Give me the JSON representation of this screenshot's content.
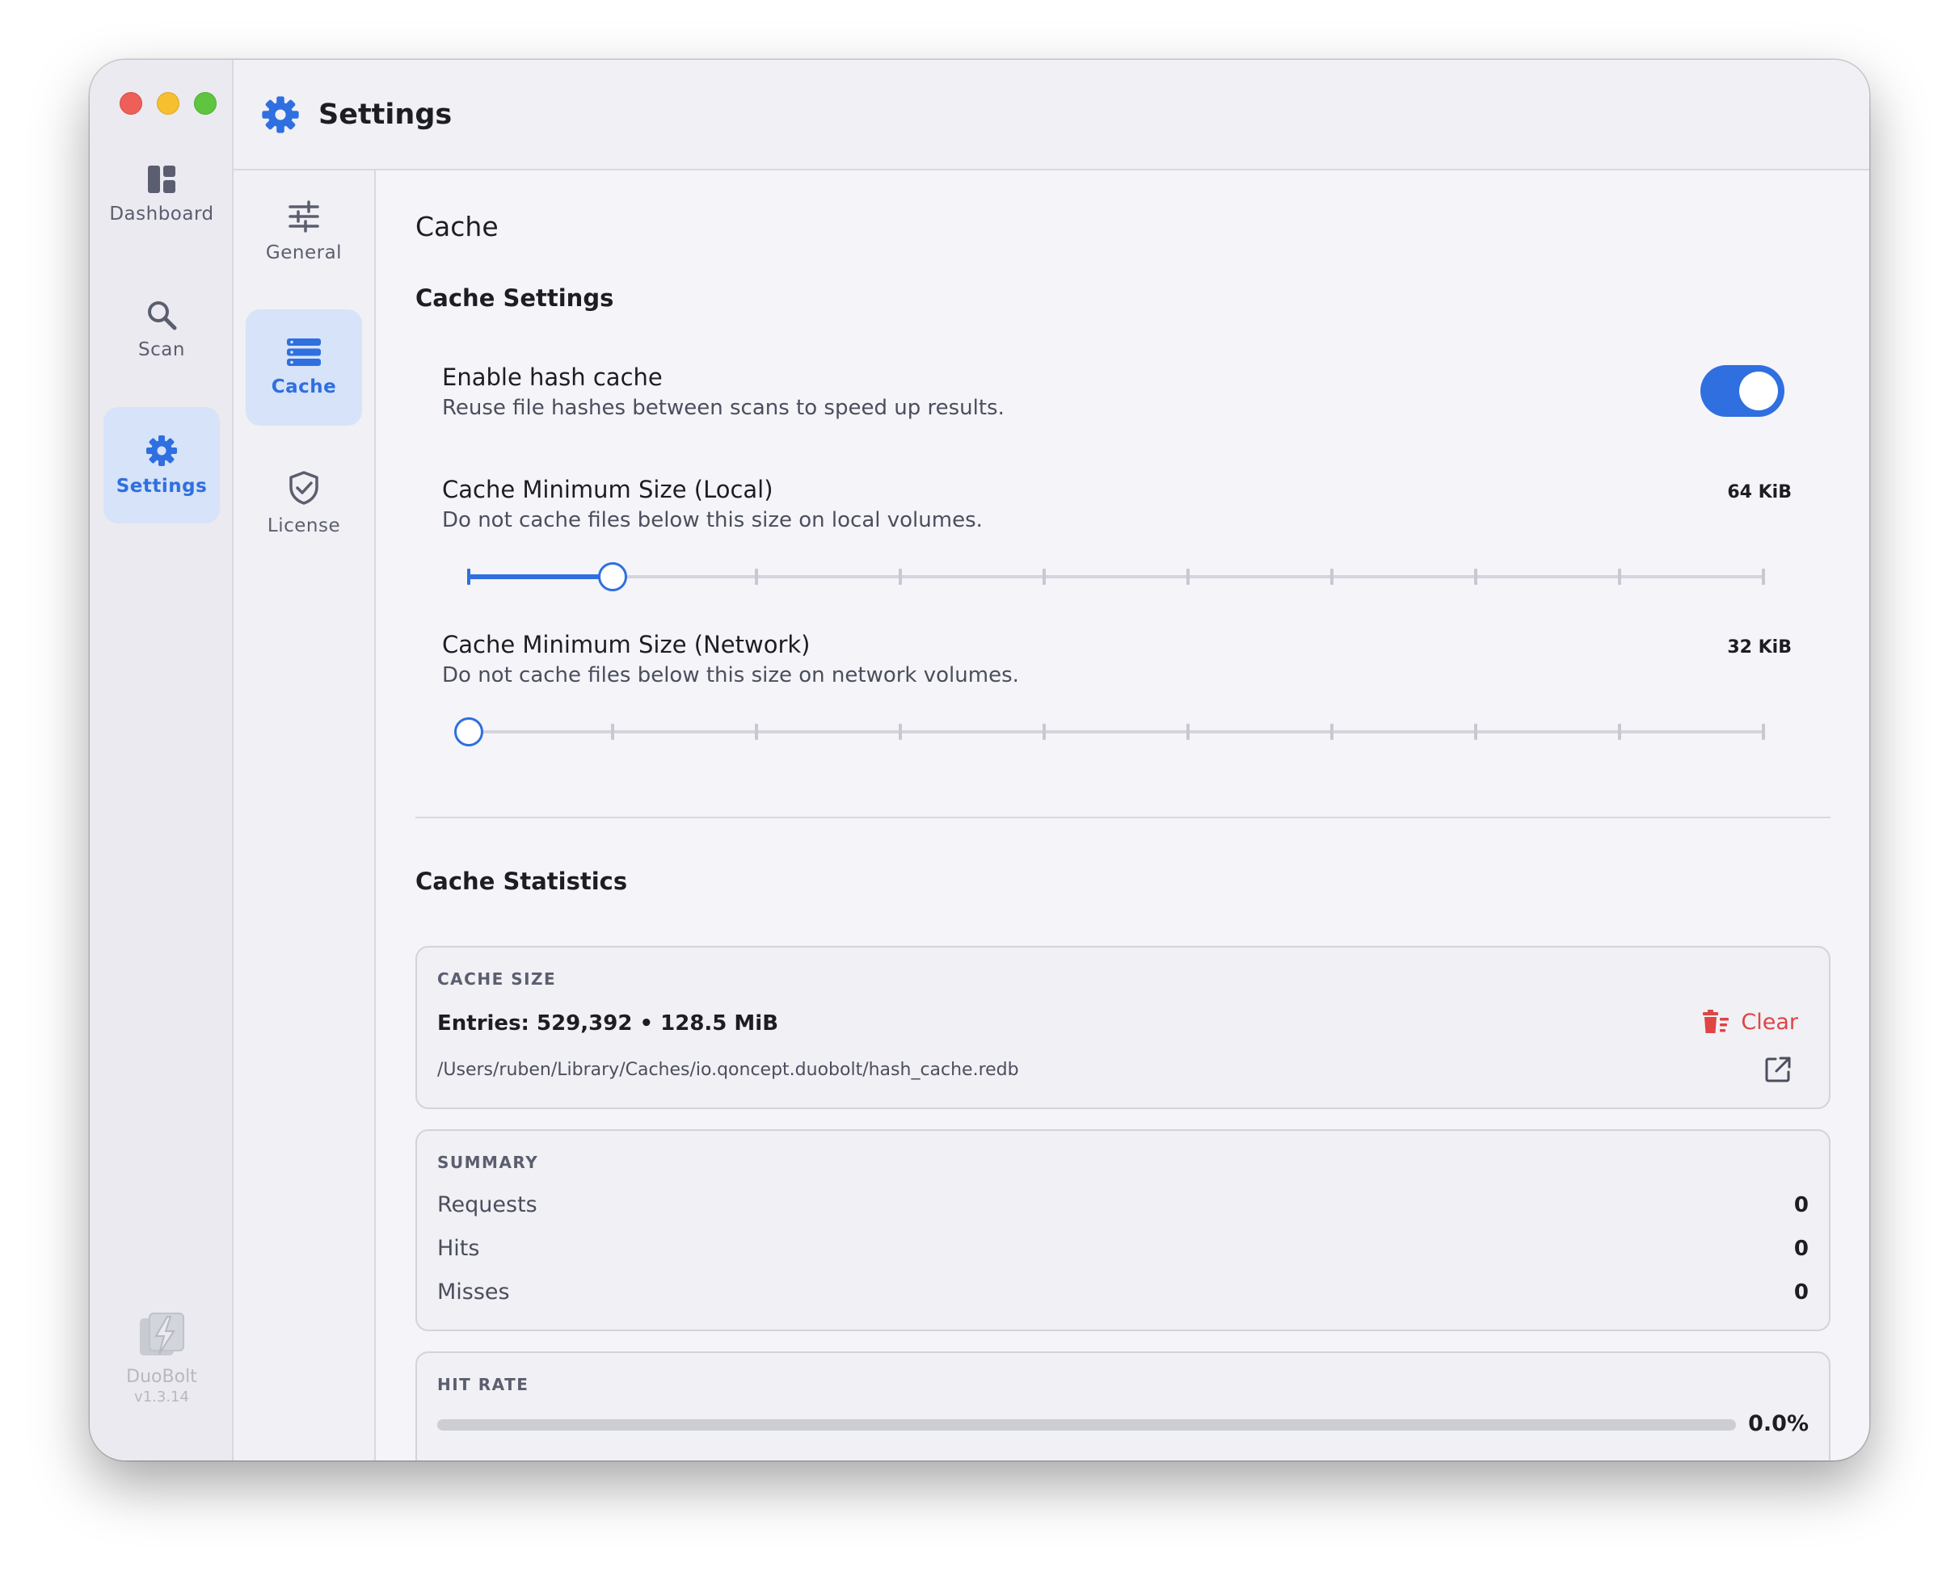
{
  "window": {
    "title": "Settings"
  },
  "rail": {
    "items": [
      {
        "label": "Dashboard",
        "icon": "dashboard-icon"
      },
      {
        "label": "Scan",
        "icon": "search-icon"
      },
      {
        "label": "Settings",
        "icon": "gear-icon",
        "active": true
      }
    ],
    "brand": {
      "name": "DuoBolt",
      "version": "v1.3.14"
    }
  },
  "subnav": {
    "items": [
      {
        "label": "General",
        "icon": "sliders-icon"
      },
      {
        "label": "Cache",
        "icon": "storage-icon",
        "active": true
      },
      {
        "label": "License",
        "icon": "shield-check-icon"
      }
    ]
  },
  "content": {
    "heading": "Cache",
    "settings_title": "Cache Settings",
    "hash_cache": {
      "title": "Enable hash cache",
      "description": "Reuse file hashes between scans to speed up results.",
      "enabled": true
    },
    "min_local": {
      "title": "Cache Minimum Size (Local)",
      "description": "Do not cache files below this size on local volumes.",
      "value": "64 KiB",
      "step_index": 1,
      "step_count": 10
    },
    "min_network": {
      "title": "Cache Minimum Size (Network)",
      "description": "Do not cache files below this size on network volumes.",
      "value": "32 KiB",
      "step_index": 0,
      "step_count": 10
    },
    "stats_title": "Cache Statistics",
    "cache_size": {
      "label": "CACHE SIZE",
      "entries": "Entries: 529,392 • 128.5 MiB",
      "path": "/Users/ruben/Library/Caches/io.qoncept.duobolt/hash_cache.redb",
      "clear_label": "Clear"
    },
    "summary": {
      "label": "SUMMARY",
      "rows": [
        {
          "name": "Requests",
          "value": "0"
        },
        {
          "name": "Hits",
          "value": "0"
        },
        {
          "name": "Misses",
          "value": "0"
        }
      ]
    },
    "hit_rate": {
      "label": "HIT RATE",
      "value": "0.0%",
      "fraction": 0.0
    }
  },
  "colors": {
    "accent": "#2f6fe0",
    "danger": "#e04444",
    "traffic_red": "#ed5f57",
    "traffic_yellow": "#f5bf2f",
    "traffic_green": "#5fc53f"
  }
}
